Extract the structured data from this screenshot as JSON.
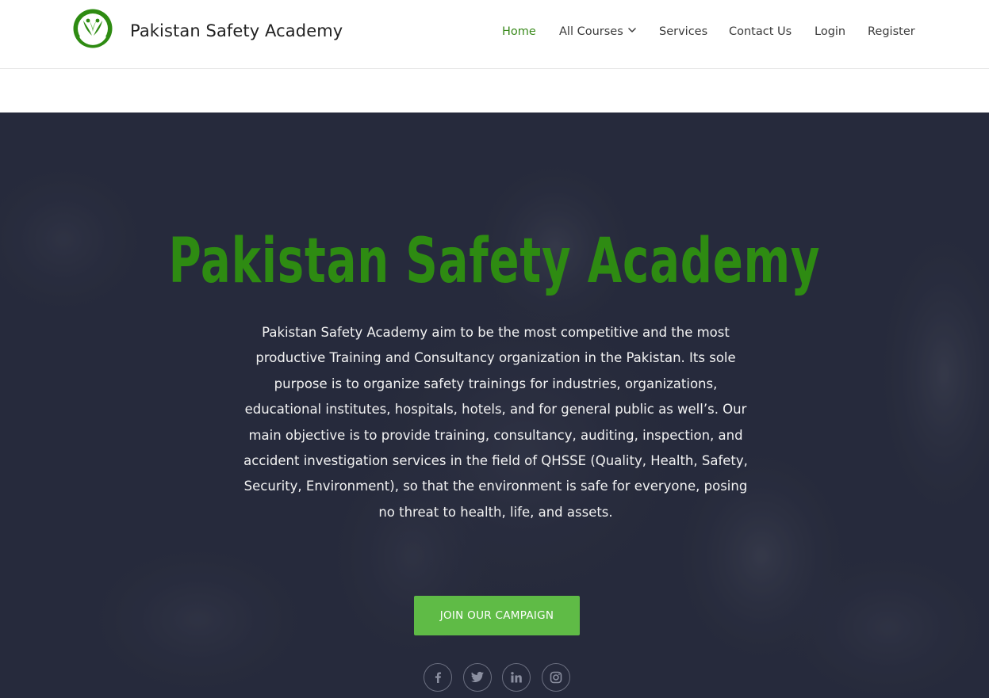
{
  "site": {
    "title": "Pakistan Safety Academy"
  },
  "nav": {
    "items": [
      {
        "label": "Home",
        "active": true
      },
      {
        "label": "All Courses",
        "has_dropdown": true
      },
      {
        "label": "Services"
      },
      {
        "label": "Contact Us"
      },
      {
        "label": "Login"
      },
      {
        "label": "Register"
      }
    ]
  },
  "hero": {
    "title": "Pakistan Safety Academy",
    "body": "Pakistan Safety Academy aim to be the most competitive and the most productive Training and Consultancy organization in the Pakistan. Its sole purpose is to organize safety trainings for industries, organizations, educational institutes, hospitals, hotels, and for general public as well’s. Our main objective is to provide training, consultancy, auditing, inspection, and accident investigation services in the field of QHSSE (Quality, Health, Safety, Security, Environment), so that the environment is safe for everyone, posing no threat to health, life, and assets.",
    "cta_label": "JOIN OUR CAMPAIGN"
  },
  "social": {
    "icons": [
      "facebook-icon",
      "twitter-icon",
      "linkedin-icon",
      "instagram-icon"
    ]
  },
  "colors": {
    "brand_green": "#2e8b12",
    "nav_active": "#3a8a1c",
    "cta_green": "#5fbb46",
    "hero_bg": "#262a3c",
    "text_dark": "#222222"
  }
}
